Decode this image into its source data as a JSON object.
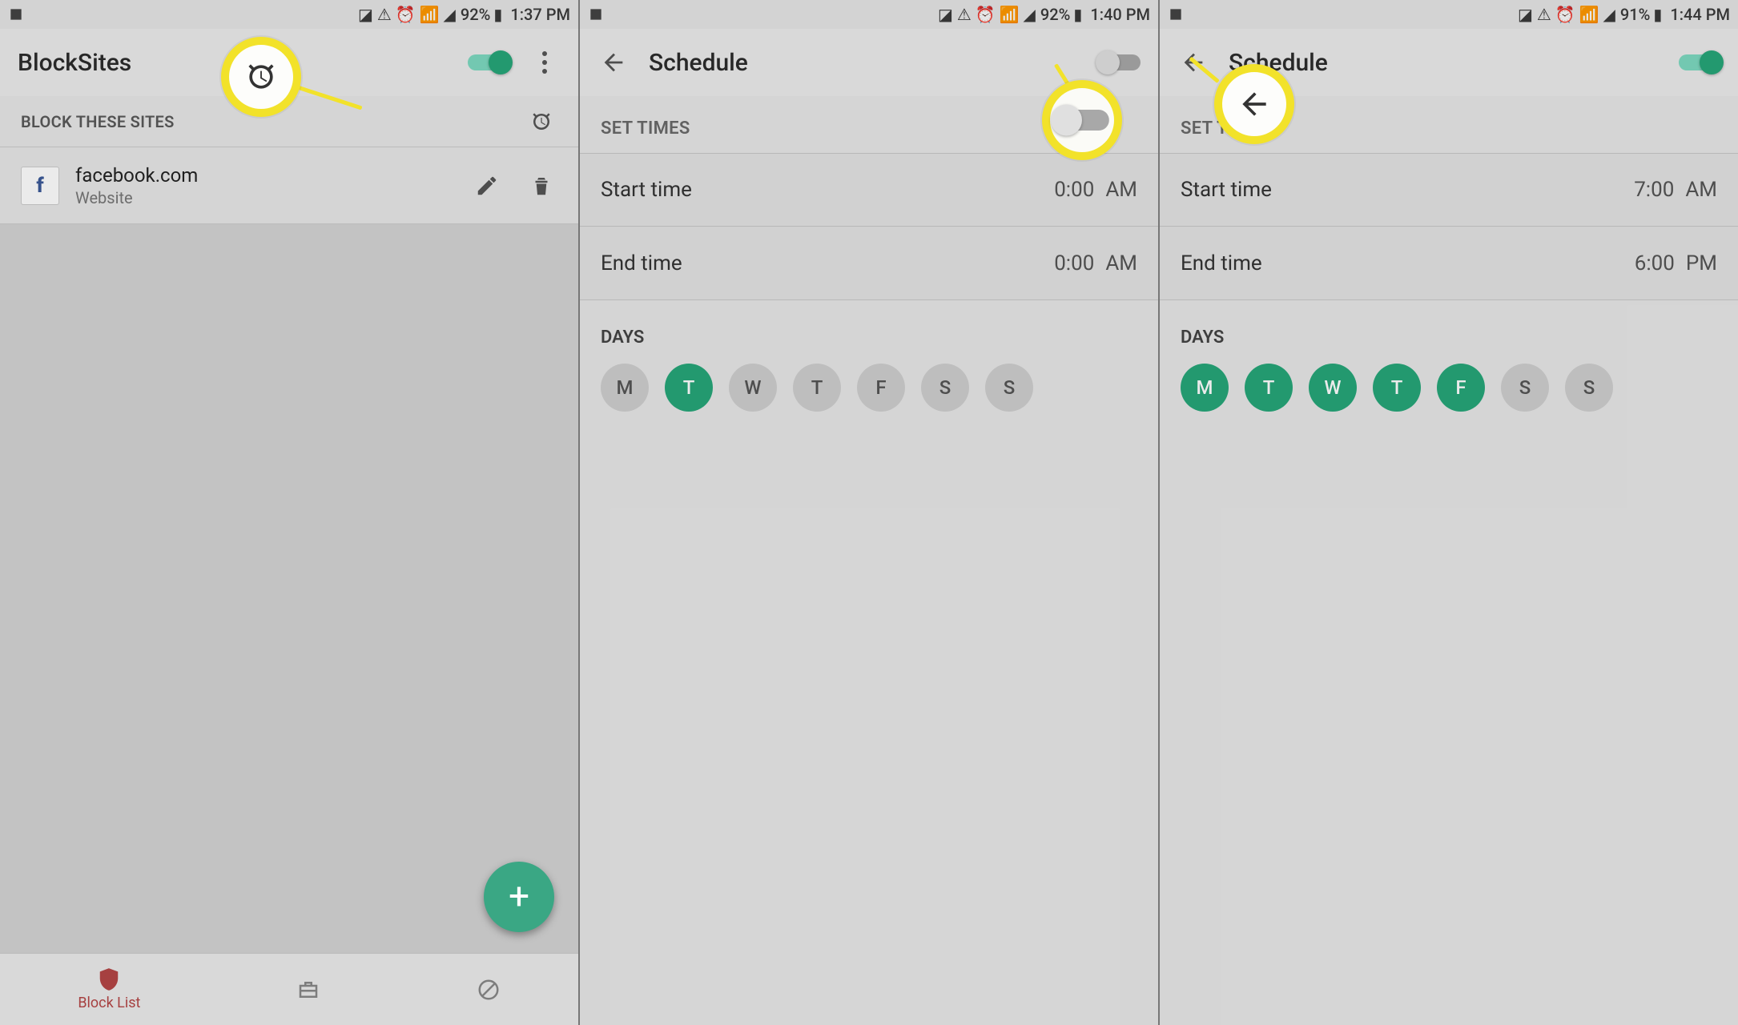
{
  "panel1": {
    "status": {
      "battery": "92%",
      "time": "1:37 PM"
    },
    "app_title": "BlockSites",
    "toggle_on": true,
    "section_label": "BLOCK THESE SITES",
    "site": {
      "name": "facebook.com",
      "subtitle": "Website"
    },
    "nav": {
      "block_list": "Block List"
    }
  },
  "panel2": {
    "status": {
      "battery": "92%",
      "time": "1:40 PM"
    },
    "app_title": "Schedule",
    "toggle_on": false,
    "set_times": "SET TIMES",
    "start_label": "Start time",
    "start_value": "0:00",
    "start_ampm": "AM",
    "end_label": "End time",
    "end_value": "0:00",
    "end_ampm": "AM",
    "days_label": "DAYS",
    "days": [
      {
        "letter": "M",
        "on": false
      },
      {
        "letter": "T",
        "on": true
      },
      {
        "letter": "W",
        "on": false
      },
      {
        "letter": "T",
        "on": false
      },
      {
        "letter": "F",
        "on": false
      },
      {
        "letter": "S",
        "on": false
      },
      {
        "letter": "S",
        "on": false
      }
    ]
  },
  "panel3": {
    "status": {
      "battery": "91%",
      "time": "1:44 PM"
    },
    "app_title": "Schedule",
    "toggle_on": true,
    "set_times": "SET TIMES",
    "start_label": "Start time",
    "start_value": "7:00",
    "start_ampm": "AM",
    "end_label": "End time",
    "end_value": "6:00",
    "end_ampm": "PM",
    "days_label": "DAYS",
    "days": [
      {
        "letter": "M",
        "on": true
      },
      {
        "letter": "T",
        "on": true
      },
      {
        "letter": "W",
        "on": true
      },
      {
        "letter": "T",
        "on": true
      },
      {
        "letter": "F",
        "on": true
      },
      {
        "letter": "S",
        "on": false
      },
      {
        "letter": "S",
        "on": false
      }
    ]
  }
}
